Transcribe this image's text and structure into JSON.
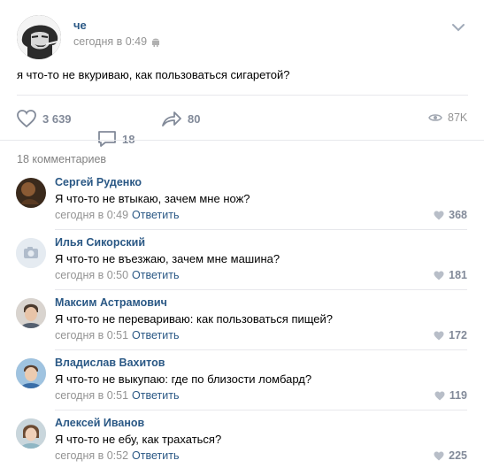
{
  "post": {
    "author": "че",
    "time": "сегодня в 0:49",
    "text": "я что-то не вкуриваю, как пользоваться сигаретой?",
    "likes": "3 639",
    "comments": "18",
    "shares": "80",
    "views": "87K"
  },
  "comments_header": "18 комментариев",
  "comments": [
    {
      "name": "Сергей Руденко",
      "text": "Я что-то не втыкаю, зачем мне нож?",
      "time": "сегодня в 0:49",
      "reply": "Ответить",
      "likes": "368"
    },
    {
      "name": "Илья Сикорский",
      "text": "Я что-то не въезжаю, зачем мне машина?",
      "time": "сегодня в 0:50",
      "reply": "Ответить",
      "likes": "181"
    },
    {
      "name": "Максим Астрамович",
      "text": "Я что-то не перевариваю: как пользоваться пищей?",
      "time": "сегодня в 0:51",
      "reply": "Ответить",
      "likes": "172"
    },
    {
      "name": "Владислав Вахитов",
      "text": "Я что-то не выкупаю: где по близости ломбард?",
      "time": "сегодня в 0:51",
      "reply": "Ответить",
      "likes": "119"
    },
    {
      "name": "Алексей Иванов",
      "text": "Я что-то не ебу, как трахаться?",
      "time": "сегодня в 0:52",
      "reply": "Ответить",
      "likes": "225"
    }
  ],
  "colors": {
    "link": "#2a5885",
    "muted": "#939393",
    "icon": "#828a99"
  },
  "icons": [
    "android-icon",
    "chevron-down-icon",
    "heart-icon",
    "comment-icon",
    "share-icon",
    "eye-icon",
    "camera-icon"
  ]
}
